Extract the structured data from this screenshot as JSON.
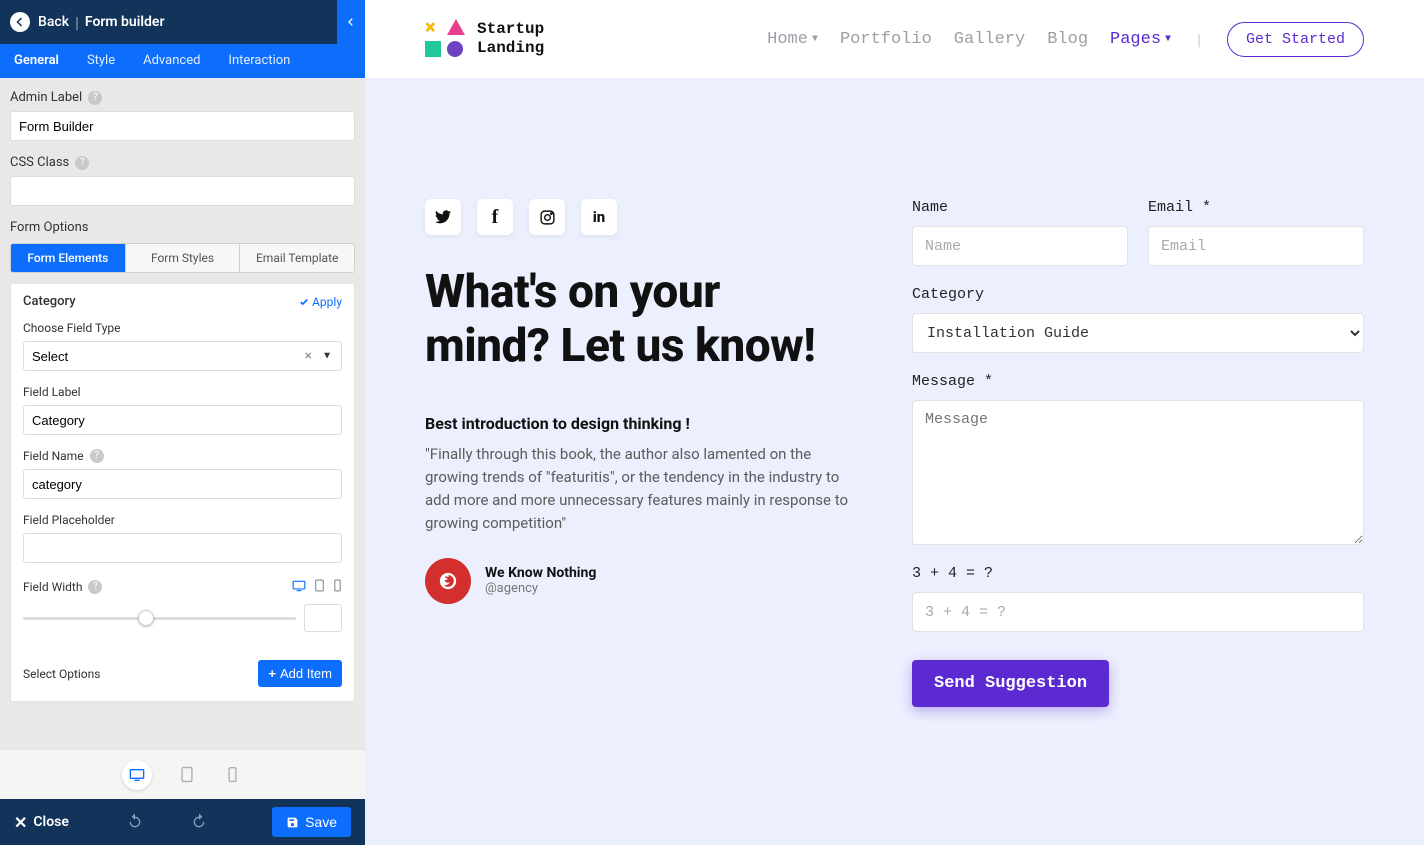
{
  "panel": {
    "back": "Back",
    "title": "Form builder",
    "tabs": [
      "General",
      "Style",
      "Advanced",
      "Interaction"
    ],
    "activeTab": 0,
    "adminLabel": {
      "label": "Admin Label",
      "value": "Form Builder"
    },
    "cssClass": {
      "label": "CSS Class",
      "value": ""
    },
    "formOptionsLabel": "Form Options",
    "subtabs": [
      "Form Elements",
      "Form Styles",
      "Email Template"
    ],
    "activeSubtab": 0,
    "card": {
      "title": "Category",
      "apply": "Apply",
      "chooseFieldTypeLabel": "Choose Field Type",
      "chooseFieldTypeValue": "Select",
      "fieldLabelLabel": "Field Label",
      "fieldLabelValue": "Category",
      "fieldNameLabel": "Field Name",
      "fieldNameValue": "category",
      "fieldPlaceholderLabel": "Field Placeholder",
      "fieldPlaceholderValue": "",
      "fieldWidthLabel": "Field Width",
      "selectOptionsLabel": "Select Options",
      "addItem": "Add Item"
    },
    "footer": {
      "close": "Close",
      "save": "Save"
    }
  },
  "site": {
    "logoLine1": "Startup",
    "logoLine2": "Landing",
    "nav": {
      "home": "Home",
      "portfolio": "Portfolio",
      "gallery": "Gallery",
      "blog": "Blog",
      "pages": "Pages",
      "cta": "Get Started"
    }
  },
  "content": {
    "headline": "What's on your mind? Let us know!",
    "subBold": "Best introduction to design thinking !",
    "para": "\"Finally through this book, the author also lamented on the growing trends of \"featuritis\", or the tendency in the industry to add more and more unnecessary features mainly in response to growing competition\"",
    "authorName": "We Know Nothing",
    "authorHandle": "@agency"
  },
  "form": {
    "name": {
      "label": "Name",
      "placeholder": "Name"
    },
    "email": {
      "label": "Email *",
      "placeholder": "Email"
    },
    "category": {
      "label": "Category",
      "value": "Installation Guide"
    },
    "message": {
      "label": "Message *",
      "placeholder": "Message"
    },
    "captcha": {
      "label": "3 + 4 = ?",
      "placeholder": "3 + 4 = ?"
    },
    "submit": "Send Suggestion"
  }
}
